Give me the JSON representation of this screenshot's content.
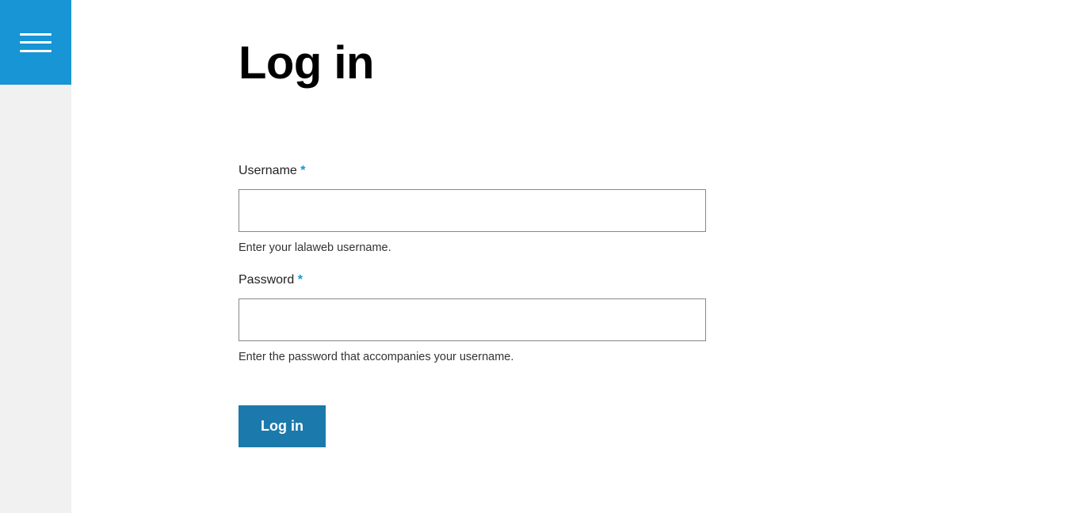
{
  "page": {
    "title": "Log in"
  },
  "form": {
    "username": {
      "label": "Username ",
      "required": "*",
      "value": "",
      "help": "Enter your lalaweb username."
    },
    "password": {
      "label": "Password ",
      "required": "*",
      "value": "",
      "help": "Enter the password that accompanies your username."
    },
    "submit_label": "Log in"
  }
}
